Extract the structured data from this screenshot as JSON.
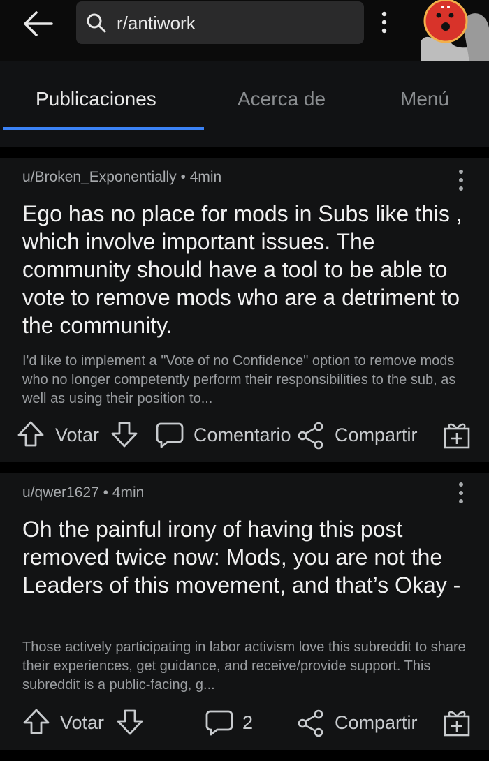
{
  "search": {
    "query": "r/antiwork"
  },
  "tabs": [
    {
      "label": "Publicaciones"
    },
    {
      "label": "Acerca de"
    },
    {
      "label": "Menú"
    }
  ],
  "posts": [
    {
      "author": "u/Broken_Exponentially",
      "time": "4min",
      "title": "Ego has no place for mods in Subs like this , which involve important issues. The community should have a tool to be able to vote to remove mods who are a detriment to the community.",
      "body": "I'd like to implement a \"Vote of no Confidence\" option to remove mods who no longer competently perform their responsibilities to the sub, as well as using their position to...",
      "vote_label": "Votar",
      "comment_label": "Comentario",
      "share_label": "Compartir"
    },
    {
      "author": "u/qwer1627",
      "time": "4min",
      "title": "Oh the painful irony of having this post removed twice now: Mods, you are not the Leaders of this movement, and that’s Okay -",
      "body": "Those actively participating in labor activism love this subreddit to share their experiences, get guidance, and receive/provide support. This subreddit is a public-facing, g...",
      "vote_label": "Votar",
      "comment_count": "2",
      "share_label": "Compartir"
    }
  ],
  "colors": {
    "accent": "#3b82f6",
    "card": "#121314",
    "search": "#2a2a2b"
  }
}
